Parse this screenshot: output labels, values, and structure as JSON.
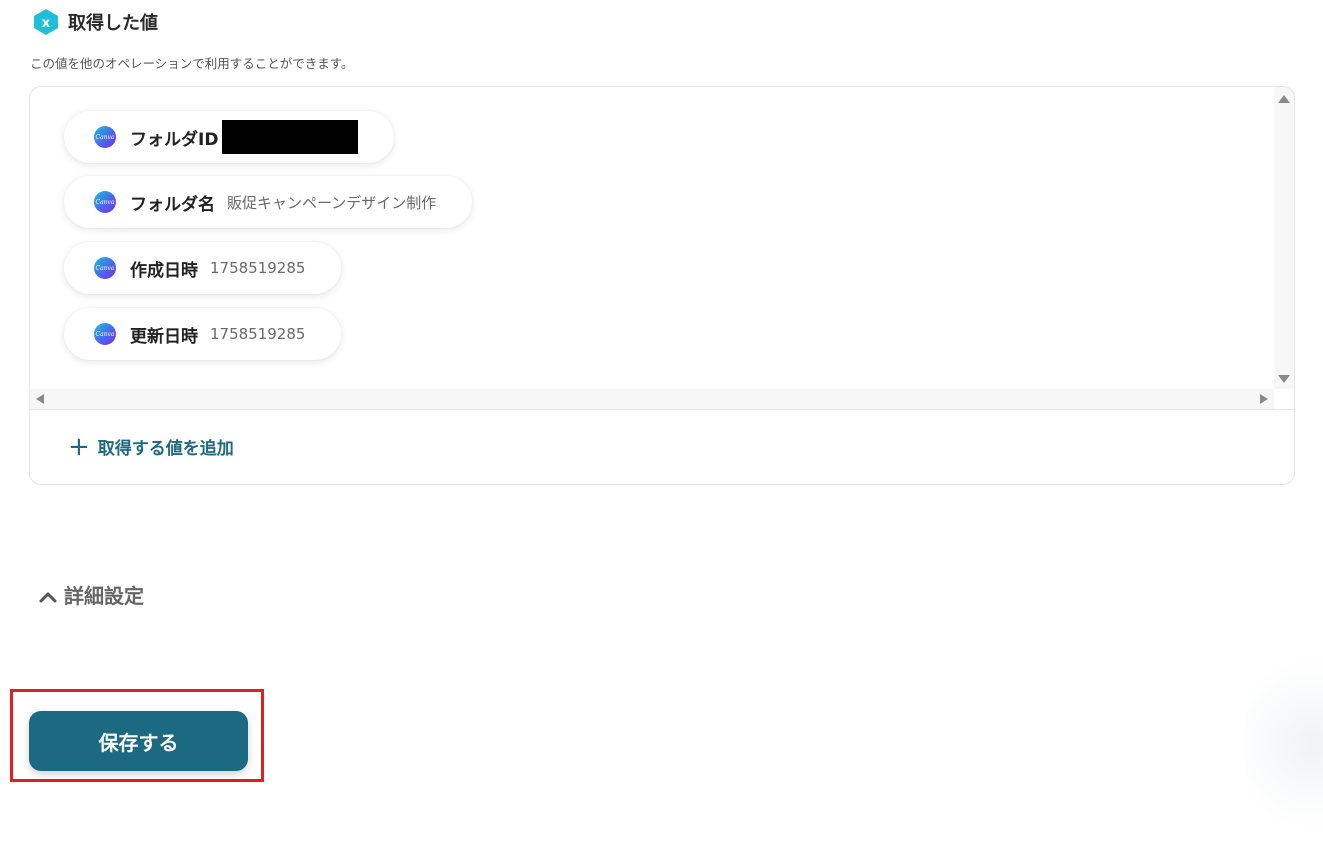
{
  "header": {
    "title": "取得した値",
    "description": "この値を他のオペレーションで利用することができます。",
    "icon": "variable-x-icon",
    "icon_color": "#1fbfd9"
  },
  "values": [
    {
      "label": "フォルダID",
      "value": "",
      "redacted": true
    },
    {
      "label": "フォルダ名",
      "value": "販促キャンペーンデザイン制作"
    },
    {
      "label": "作成日時",
      "value": "1758519285"
    },
    {
      "label": "更新日時",
      "value": "1758519285"
    }
  ],
  "add_value_label": "取得する値を追加",
  "advanced_settings_label": "詳細設定",
  "save_label": "保存する",
  "colors": {
    "accent": "#1b6a82",
    "highlight": "#e02020"
  },
  "logo_text": "Canva"
}
